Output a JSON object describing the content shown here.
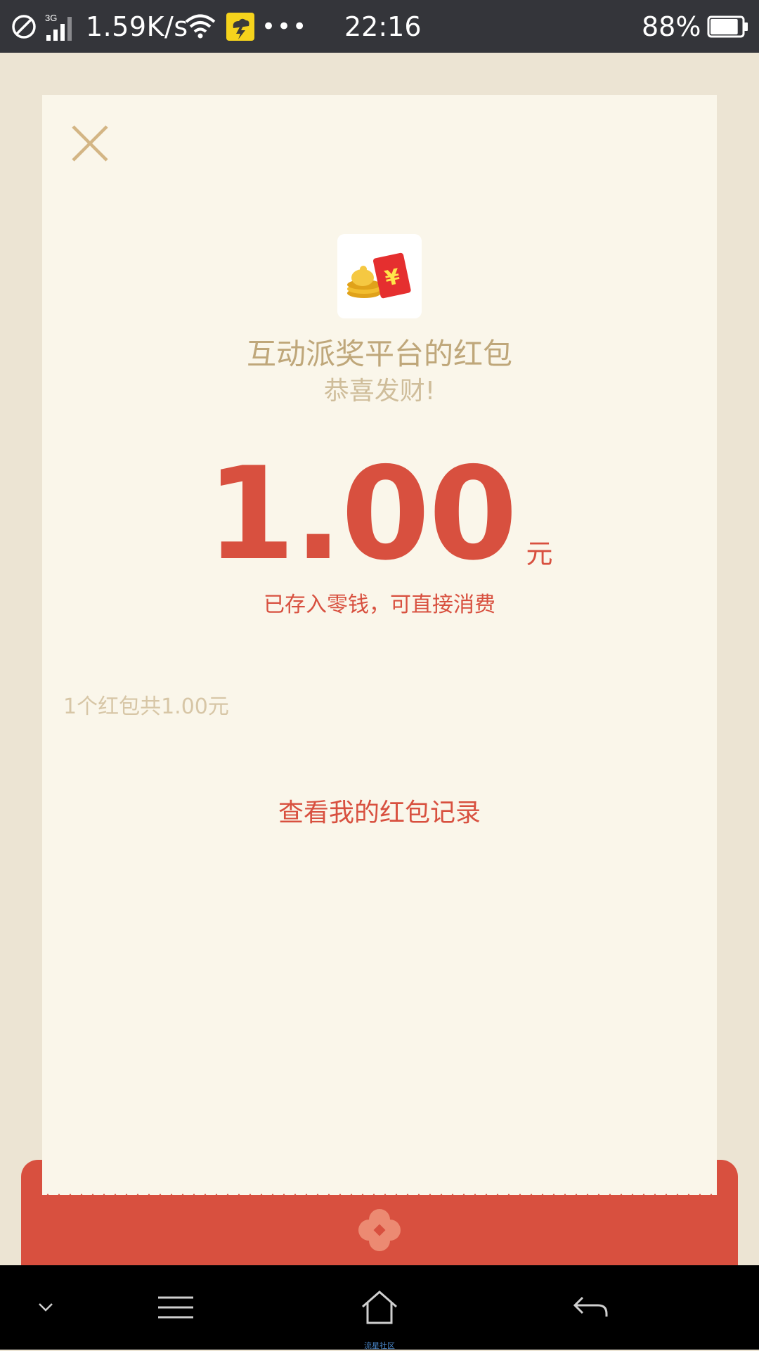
{
  "status_bar": {
    "network_type": "3G",
    "speed": "1.59K/s",
    "more": "•••",
    "time": "22:16",
    "battery_percent": "88%",
    "battery_level": 0.88
  },
  "header": {
    "close_icon": "close-icon",
    "logo_icon": "red-envelope-coins-icon",
    "sender_name": "互动派奖平台的红包",
    "greeting": "恭喜发财!"
  },
  "amount": {
    "value": "1.00",
    "unit": "元",
    "note": "已存入零钱，可直接消费"
  },
  "summary": "1个红包共1.00元",
  "records_link": "查看我的红包记录",
  "nav_bar": {
    "watermark": "流星社区"
  },
  "colors": {
    "accent_red": "#d8503f",
    "gold_text": "#bfa77a",
    "card_bg": "#faf6ea",
    "page_bg": "#ece4d3"
  }
}
